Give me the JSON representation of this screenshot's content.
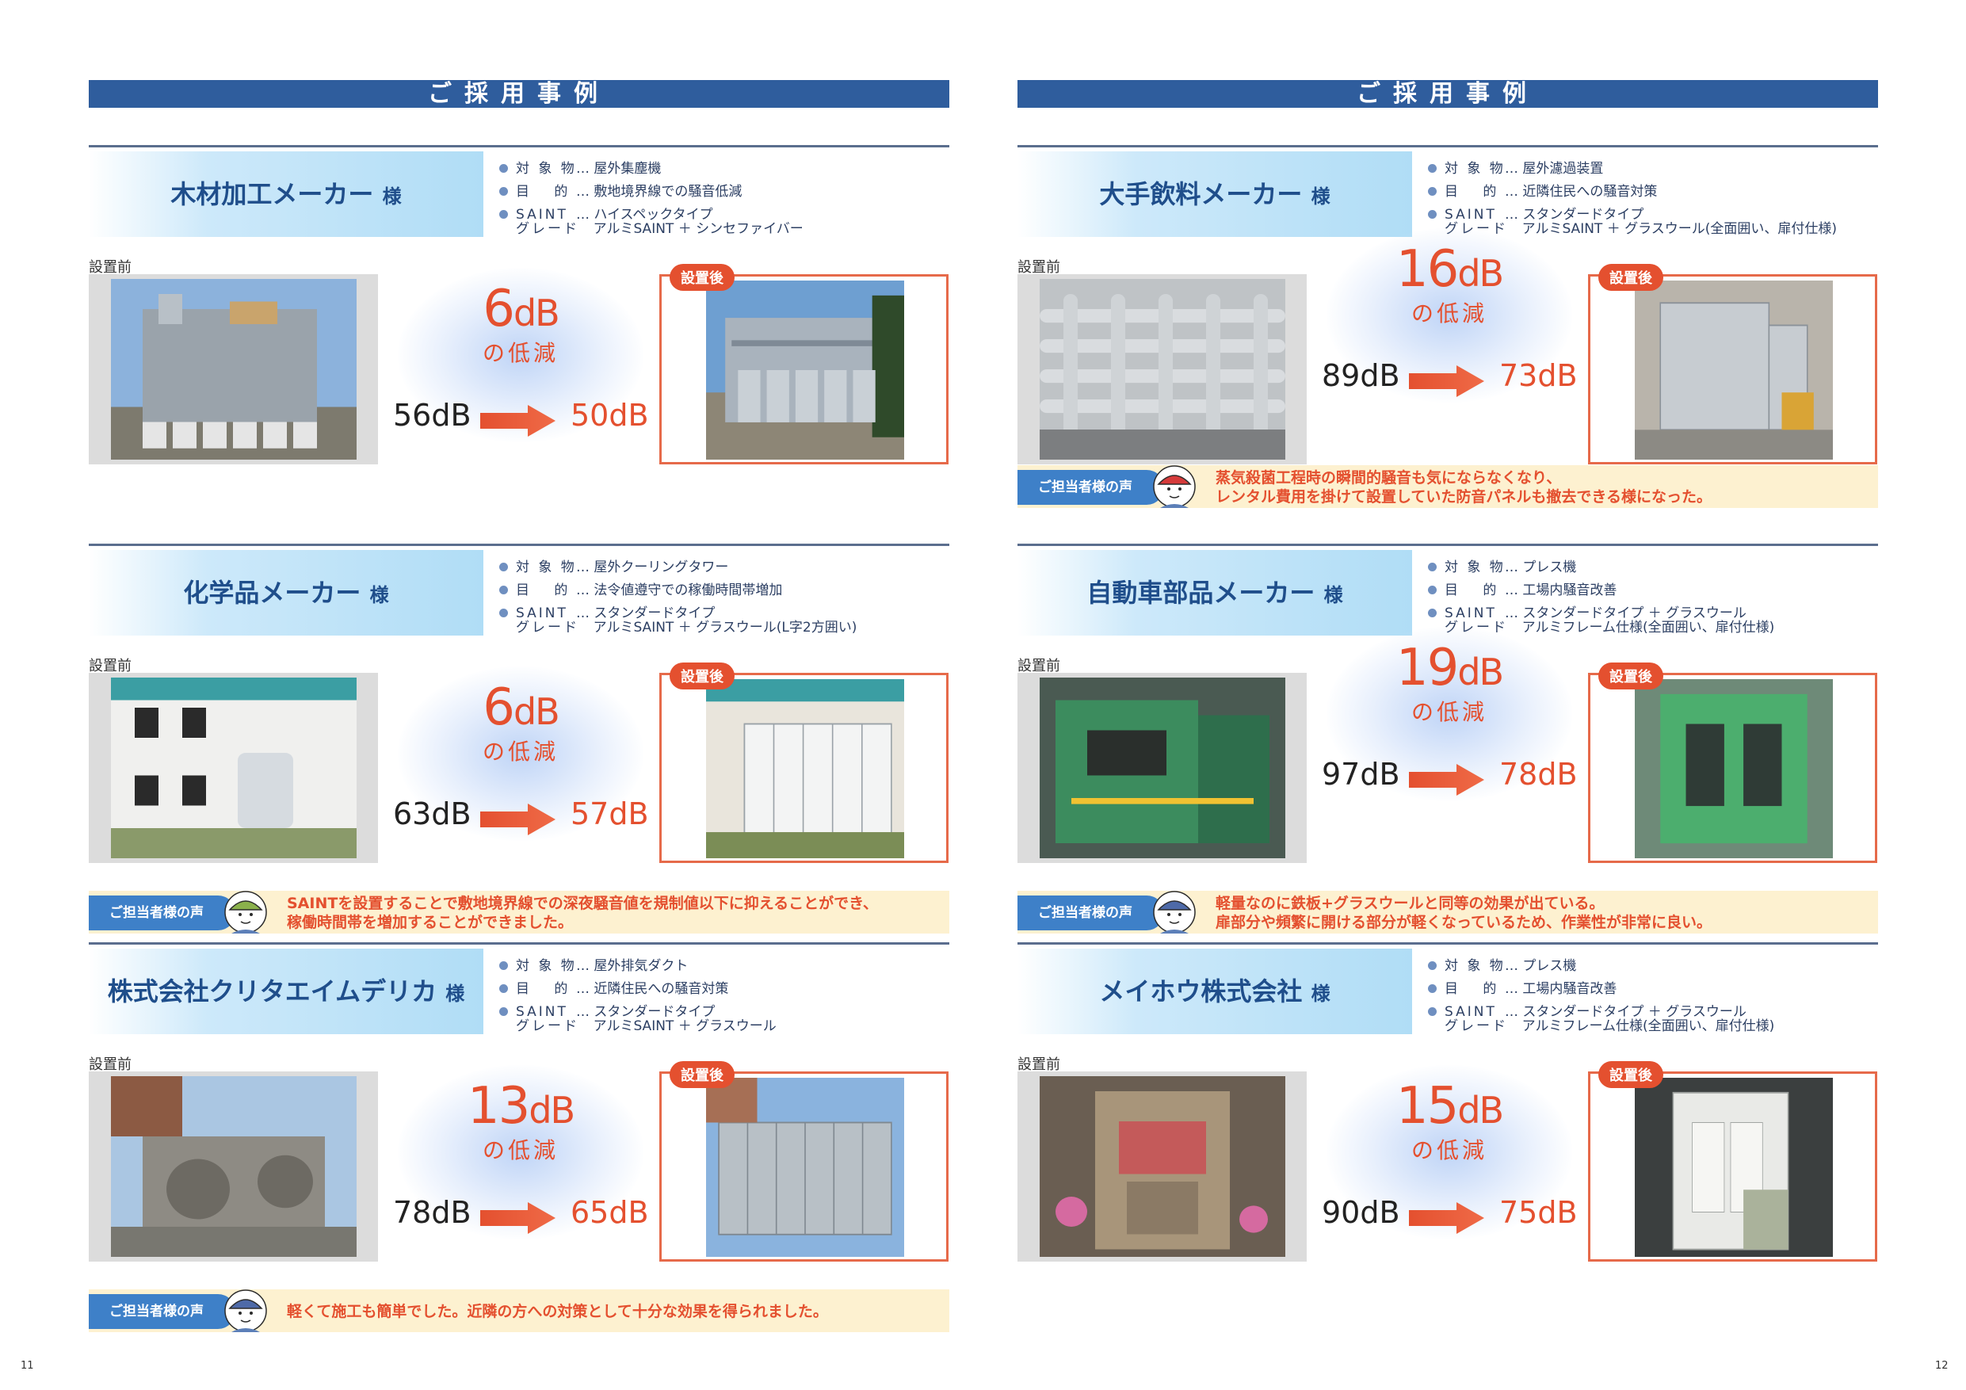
{
  "banners": {
    "left": "ご採用事例",
    "right": "ご採用事例"
  },
  "labels": {
    "before": "設置前",
    "after": "設置後",
    "voice": "ご担当者様の声",
    "teigen": "の低減",
    "sama": "様",
    "db_unit": "dB"
  },
  "spec_keys": {
    "target": "対 象 物",
    "purpose": "目　 的",
    "saint": "SAINT",
    "grade": "グレード",
    "sep": "…"
  },
  "cases": [
    {
      "name": "木材加工メーカー",
      "target": "屋外集塵機",
      "purpose": "敷地境界線での騒音低減",
      "saint": "ハイスペックタイプ",
      "grade": "アルミSAINT ＋ シンセファイバー",
      "reduction": "6",
      "from": "56dB",
      "to": "50dB",
      "voice": []
    },
    {
      "name": "化学品メーカー",
      "target": "屋外クーリングタワー",
      "purpose": "法令値遵守での稼働時間帯増加",
      "saint": "スタンダードタイプ",
      "grade": "アルミSAINT ＋ グラスウール(L字2方囲い)",
      "reduction": "6",
      "from": "63dB",
      "to": "57dB",
      "voice": [
        "SAINTを設置することで敷地境界線での深夜騒音値を規制値以下に抑えることができ、",
        "稼働時間帯を増加することができました。"
      ]
    },
    {
      "name": "株式会社クリタエイムデリカ",
      "target": "屋外排気ダクト",
      "purpose": "近隣住民への騒音対策",
      "saint": "スタンダードタイプ",
      "grade": "アルミSAINT ＋ グラスウール",
      "reduction": "13",
      "from": "78dB",
      "to": "65dB",
      "voice": [
        "軽くて施工も簡単でした。近隣の方への対策として十分な効果を得られました。"
      ]
    },
    {
      "name": "大手飲料メーカー",
      "target": "屋外濾過装置",
      "purpose": "近隣住民への騒音対策",
      "saint": "スタンダードタイプ",
      "grade": "アルミSAINT ＋ グラスウール(全面囲い、扉付仕様)",
      "reduction": "16",
      "from": "89dB",
      "to": "73dB",
      "voice": [
        "蒸気殺菌工程時の瞬間的騒音も気にならなくなり、",
        "レンタル費用を掛けて設置していた防音パネルも撤去できる様になった。"
      ]
    },
    {
      "name": "自動車部品メーカー",
      "target": "プレス機",
      "purpose": "工場内騒音改善",
      "saint": "スタンダードタイプ ＋ グラスウール",
      "grade": "アルミフレーム仕様(全面囲い、扉付仕様)",
      "reduction": "19",
      "from": "97dB",
      "to": "78dB",
      "voice": [
        "軽量なのに鉄板+グラスウールと同等の効果が出ている。",
        "扉部分や頻繁に開ける部分が軽くなっているため、作業性が非常に良い。"
      ]
    },
    {
      "name": "メイホウ株式会社",
      "target": "プレス機",
      "purpose": "工場内騒音改善",
      "saint": "スタンダードタイプ ＋ グラスウール",
      "grade": "アルミフレーム仕様(全面囲い、扉付仕様)",
      "reduction": "15",
      "from": "90dB",
      "to": "75dB",
      "voice": []
    }
  ],
  "page_numbers": {
    "left": "11",
    "right": "12"
  },
  "colors": {
    "navy": "#2f5d9d",
    "accent": "#e4502f",
    "voice_bg": "#fdf1d0",
    "voice_tag": "#3e80c8"
  }
}
